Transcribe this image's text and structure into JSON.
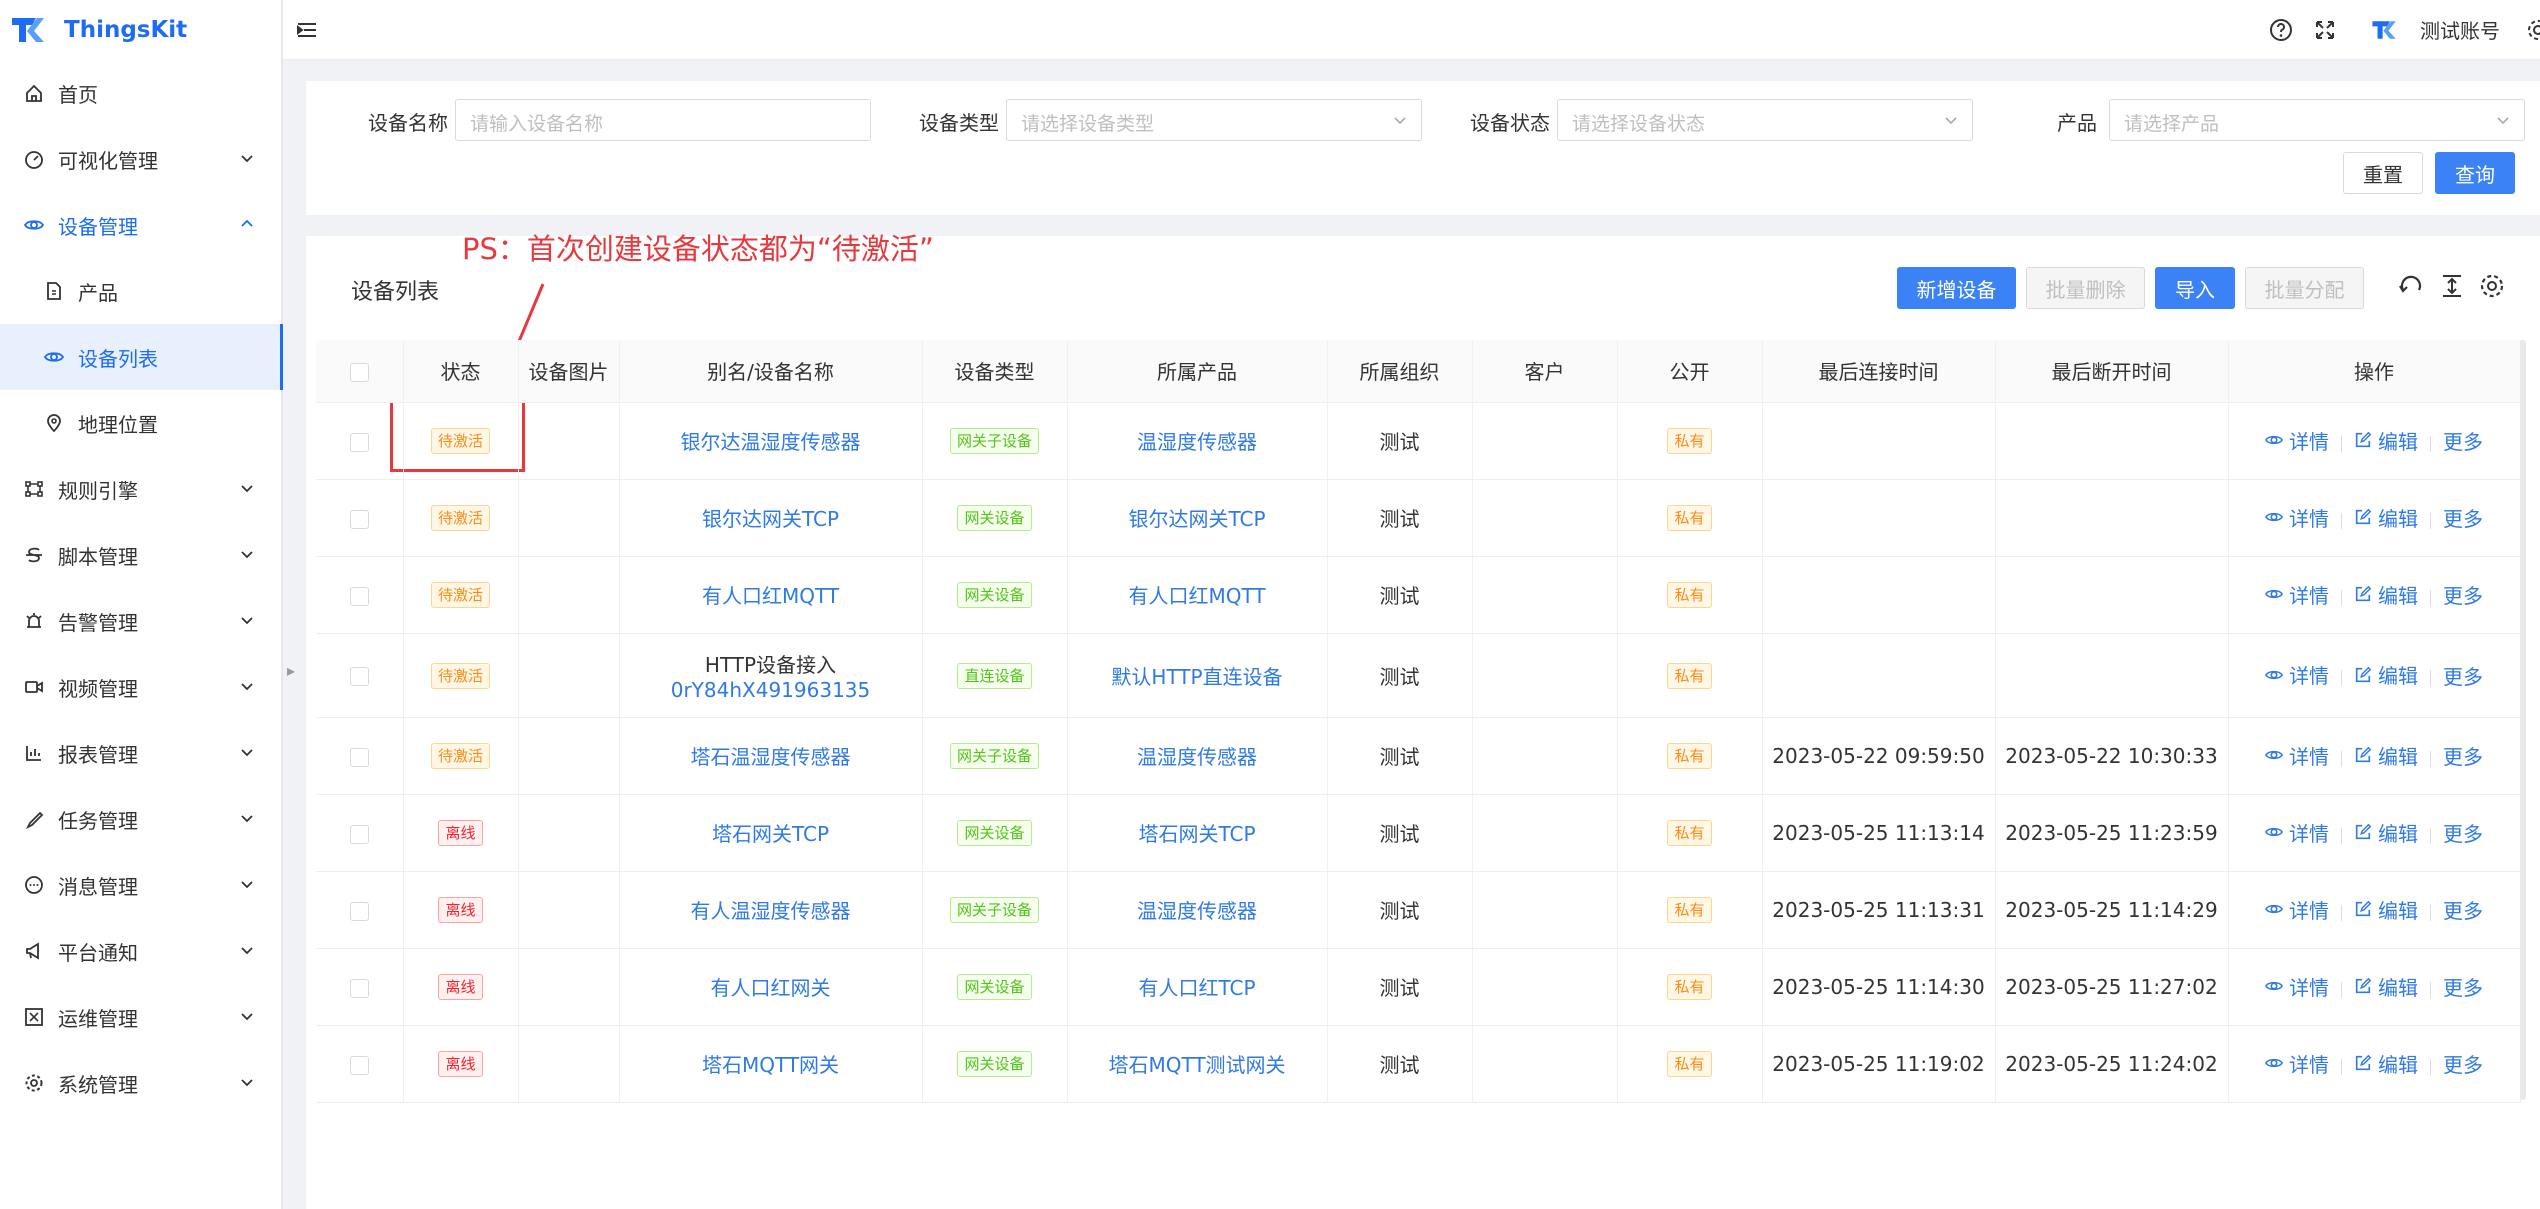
{
  "app": {
    "name": "ThingsKit",
    "brand_color": "#1d6cf2"
  },
  "topbar": {
    "user_name": "测试账号",
    "icons": [
      "menu-fold-icon",
      "help-icon",
      "fullscreen-icon",
      "settings-icon"
    ]
  },
  "sidebar": {
    "items": [
      {
        "label": "首页",
        "icon": "home-icon",
        "level": 1,
        "chevron": false
      },
      {
        "label": "可视化管理",
        "icon": "dashboard-icon",
        "level": 1,
        "chevron": "down"
      },
      {
        "label": "设备管理",
        "icon": "eye-icon",
        "level": 1,
        "chevron": "up",
        "open": true
      },
      {
        "label": "产品",
        "icon": "file-icon",
        "level": 2,
        "chevron": false
      },
      {
        "label": "设备列表",
        "icon": "eye-icon",
        "level": 2,
        "chevron": false,
        "active": true
      },
      {
        "label": "地理位置",
        "icon": "location-icon",
        "level": 2,
        "chevron": false
      },
      {
        "label": "规则引擎",
        "icon": "rule-icon",
        "level": 1,
        "chevron": "down"
      },
      {
        "label": "脚本管理",
        "icon": "script-icon",
        "level": 1,
        "chevron": "down"
      },
      {
        "label": "告警管理",
        "icon": "alarm-icon",
        "level": 1,
        "chevron": "down"
      },
      {
        "label": "视频管理",
        "icon": "video-icon",
        "level": 1,
        "chevron": "down"
      },
      {
        "label": "报表管理",
        "icon": "report-icon",
        "level": 1,
        "chevron": "down"
      },
      {
        "label": "任务管理",
        "icon": "task-icon",
        "level": 1,
        "chevron": "down"
      },
      {
        "label": "消息管理",
        "icon": "message-icon",
        "level": 1,
        "chevron": "down"
      },
      {
        "label": "平台通知",
        "icon": "notice-icon",
        "level": 1,
        "chevron": "down"
      },
      {
        "label": "运维管理",
        "icon": "ops-icon",
        "level": 1,
        "chevron": "down"
      },
      {
        "label": "系统管理",
        "icon": "system-icon",
        "level": 1,
        "chevron": "down"
      }
    ]
  },
  "search": {
    "device_name": {
      "label": "设备名称",
      "placeholder": "请输入设备名称"
    },
    "device_type": {
      "label": "设备类型",
      "placeholder": "请选择设备类型"
    },
    "device_status": {
      "label": "设备状态",
      "placeholder": "请选择设备状态"
    },
    "product": {
      "label": "产品",
      "placeholder": "请选择产品"
    },
    "reset_label": "重置",
    "query_label": "查询"
  },
  "list": {
    "title": "设备列表",
    "annotation": "PS：首次创建设备状态都为“待激活”",
    "annotation_color": "#e8383d",
    "buttons": {
      "add": "新增设备",
      "batch_delete": "批量删除",
      "import": "导入",
      "batch_assign": "批量分配"
    },
    "columns": [
      "状态",
      "设备图片",
      "别名/设备名称",
      "设备类型",
      "所属产品",
      "所属组织",
      "客户",
      "公开",
      "最后连接时间",
      "最后断开时间",
      "操作"
    ],
    "rows": [
      {
        "status": "待激活",
        "status_color": "orange",
        "name": "银尔达温湿度传感器",
        "type": "网关子设备",
        "product": "温湿度传感器",
        "org": "测试",
        "customer": "",
        "public": "私有",
        "last_connect": "",
        "last_disconnect": ""
      },
      {
        "status": "待激活",
        "status_color": "orange",
        "name": "银尔达网关TCP",
        "type": "网关设备",
        "product": "银尔达网关TCP",
        "org": "测试",
        "customer": "",
        "public": "私有",
        "last_connect": "",
        "last_disconnect": ""
      },
      {
        "status": "待激活",
        "status_color": "orange",
        "name": "有人口红MQTT",
        "type": "网关设备",
        "product": "有人口红MQTT",
        "org": "测试",
        "customer": "",
        "public": "私有",
        "last_connect": "",
        "last_disconnect": ""
      },
      {
        "status": "待激活",
        "status_color": "orange",
        "alias": "HTTP设备接入",
        "name": "0rY84hX491963135",
        "type": "直连设备",
        "product": "默认HTTP直连设备",
        "org": "测试",
        "customer": "",
        "public": "私有",
        "last_connect": "",
        "last_disconnect": ""
      },
      {
        "status": "待激活",
        "status_color": "orange",
        "name": "塔石温湿度传感器",
        "type": "网关子设备",
        "product": "温湿度传感器",
        "org": "测试",
        "customer": "",
        "public": "私有",
        "last_connect": "2023-05-22 09:59:50",
        "last_disconnect": "2023-05-22 10:30:33"
      },
      {
        "status": "离线",
        "status_color": "red",
        "name": "塔石网关TCP",
        "type": "网关设备",
        "product": "塔石网关TCP",
        "org": "测试",
        "customer": "",
        "public": "私有",
        "last_connect": "2023-05-25 11:13:14",
        "last_disconnect": "2023-05-25 11:23:59"
      },
      {
        "status": "离线",
        "status_color": "red",
        "name": "有人温湿度传感器",
        "type": "网关子设备",
        "product": "温湿度传感器",
        "org": "测试",
        "customer": "",
        "public": "私有",
        "last_connect": "2023-05-25 11:13:31",
        "last_disconnect": "2023-05-25 11:14:29"
      },
      {
        "status": "离线",
        "status_color": "red",
        "name": "有人口红网关",
        "type": "网关设备",
        "product": "有人口红TCP",
        "org": "测试",
        "customer": "",
        "public": "私有",
        "last_connect": "2023-05-25 11:14:30",
        "last_disconnect": "2023-05-25 11:27:02"
      },
      {
        "status": "离线",
        "status_color": "red",
        "name": "塔石MQTT网关",
        "type": "网关设备",
        "product": "塔石MQTT测试网关",
        "org": "测试",
        "customer": "",
        "public": "私有",
        "last_connect": "2023-05-25 11:19:02",
        "last_disconnect": "2023-05-25 11:24:02"
      }
    ],
    "row_actions": {
      "detail": "详情",
      "edit": "编辑",
      "more": "更多"
    }
  }
}
